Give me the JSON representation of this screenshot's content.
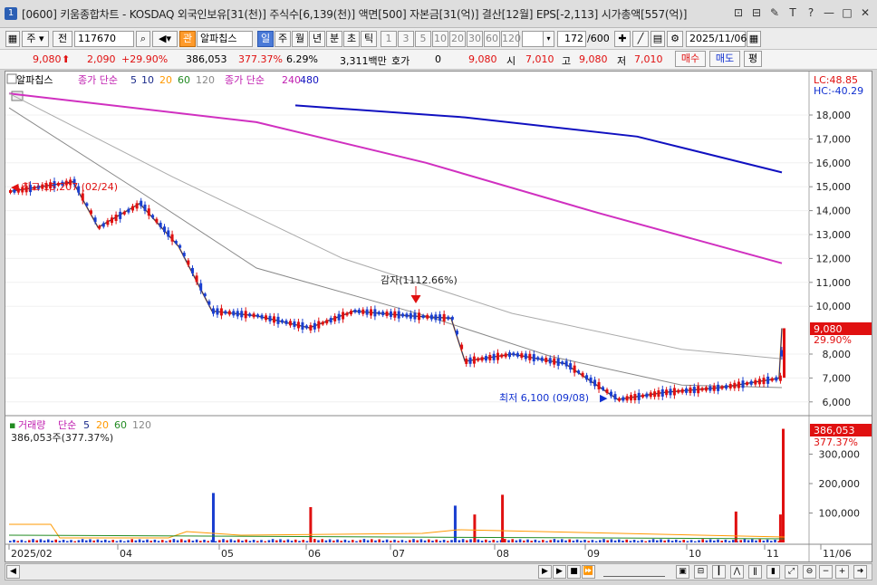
{
  "window": {
    "badge": "1",
    "title": "[0600] 키움종합차트 - KOSDAQ 외국인보유[31(천)] 주식수[6,139(천)] 액면[500] 자본금[31(억)] 결산[12월] EPS[-2,113] 시가총액[557(억)]",
    "buttons": [
      "⊡",
      "⊟",
      "✎",
      "T",
      "?",
      "—",
      "□",
      "✕"
    ]
  },
  "toolbar": {
    "menu_label": "주",
    "all_label": "전",
    "code_value": "117670",
    "name_tag": "관",
    "stock_name": "알파칩스",
    "periods": [
      "일",
      "주",
      "월",
      "년",
      "분",
      "초",
      "틱"
    ],
    "active_period": "일",
    "intervals": [
      "1",
      "3",
      "5",
      "10",
      "20",
      "30",
      "60",
      "120"
    ],
    "count_value": "172",
    "count_total": "/600",
    "date_value": "2025/11/06"
  },
  "quote": {
    "price": "9,080",
    "change": "2,090",
    "change_pct": "+29.90%",
    "volume": "386,053",
    "vol_ratio": "377.37%",
    "turnover": "6.29%",
    "amount": "3,311백만",
    "bid_label": "호가",
    "bid_value": "0",
    "bid_price": "9,080",
    "open_label": "시",
    "open": "7,010",
    "high_label": "고",
    "high": "9,080",
    "low_label": "저",
    "low": "7,010",
    "buy_label": "매수",
    "sell_label": "매도",
    "eval_label": "평"
  },
  "colors": {
    "up": "#e01010",
    "down": "#1a3fd0",
    "ma5": "#1a2a8a",
    "ma10": "#ff9900",
    "ma20": "#228b22",
    "ma60": "#888888",
    "ma120": "#aaaaaa",
    "ma240": "#d030c0",
    "ma480": "#1010c0"
  },
  "chart_data": [
    {
      "type": "candlestick",
      "title": "알파칩스",
      "legend": {
        "ma_label": "종가 단순",
        "ma_periods": [
          "5",
          "10",
          "20",
          "60",
          "120"
        ],
        "ma_long_label": "종가 단순",
        "ma_long_periods": [
          "240",
          "480"
        ]
      },
      "corner_labels": {
        "lc": "LC:48.85",
        "hc": "HC:-40.29"
      },
      "y_ticks": [
        "18,000",
        "17,000",
        "16,000",
        "15,000",
        "14,000",
        "13,000",
        "12,000",
        "11,000",
        "10,000",
        "8,000",
        "7,000",
        "6,000"
      ],
      "ylim": [
        5800,
        19000
      ],
      "current_price": "9,080",
      "current_pct": "29.90%",
      "annotations": {
        "high": "최고 15,207 (02/24)",
        "low": "최저 6,100 (09/08)",
        "event": "감자(1112.66%)"
      },
      "x_labels": [
        "2025/02",
        "04",
        "05",
        "06",
        "07",
        "08",
        "09",
        "10",
        "11",
        "11/06"
      ],
      "price_series": [
        {
          "x": "2025-02-01",
          "close": 14800
        },
        {
          "x": "2025-02-24",
          "close": 15207
        },
        {
          "x": "2025-03-05",
          "close": 13300
        },
        {
          "x": "2025-03-20",
          "close": 14300
        },
        {
          "x": "2025-04-03",
          "close": 12500
        },
        {
          "x": "2025-04-15",
          "close": 9800
        },
        {
          "x": "2025-05-01",
          "close": 9600
        },
        {
          "x": "2025-05-20",
          "close": 9100
        },
        {
          "x": "2025-06-05",
          "close": 9800
        },
        {
          "x": "2025-06-25",
          "close": 9600
        },
        {
          "x": "2025-07-10",
          "close": 9500
        },
        {
          "x": "2025-07-15",
          "close": 7700
        },
        {
          "x": "2025-08-01",
          "close": 8000
        },
        {
          "x": "2025-08-20",
          "close": 7600
        },
        {
          "x": "2025-09-08",
          "close": 6100
        },
        {
          "x": "2025-09-25",
          "close": 6400
        },
        {
          "x": "2025-10-15",
          "close": 6600
        },
        {
          "x": "2025-11-05",
          "close": 6990
        },
        {
          "x": "2025-11-06",
          "close": 9080
        }
      ],
      "ma240": [
        {
          "x": "2025-02-01",
          "y": 18900
        },
        {
          "x": "2025-05-01",
          "y": 17700
        },
        {
          "x": "2025-07-01",
          "y": 16000
        },
        {
          "x": "2025-09-01",
          "y": 13900
        },
        {
          "x": "2025-11-06",
          "y": 11800
        }
      ],
      "ma480": [
        {
          "x": "2025-05-15",
          "y": 18400
        },
        {
          "x": "2025-07-15",
          "y": 17900
        },
        {
          "x": "2025-09-15",
          "y": 17100
        },
        {
          "x": "2025-11-06",
          "y": 15600
        }
      ],
      "ma120": [
        {
          "x": "2025-02-01",
          "y": 18900
        },
        {
          "x": "2025-04-01",
          "y": 15400
        },
        {
          "x": "2025-06-01",
          "y": 12000
        },
        {
          "x": "2025-08-01",
          "y": 9700
        },
        {
          "x": "2025-10-01",
          "y": 8200
        },
        {
          "x": "2025-11-06",
          "y": 7800
        }
      ],
      "ma60": [
        {
          "x": "2025-02-01",
          "y": 18300
        },
        {
          "x": "2025-03-20",
          "y": 14800
        },
        {
          "x": "2025-05-01",
          "y": 11600
        },
        {
          "x": "2025-07-01",
          "y": 9600
        },
        {
          "x": "2025-08-15",
          "y": 7900
        },
        {
          "x": "2025-10-01",
          "y": 6700
        },
        {
          "x": "2025-11-06",
          "y": 6600
        }
      ]
    },
    {
      "type": "bar",
      "title": "거래량",
      "legend": {
        "ma_label": "단순",
        "ma_periods": [
          "5",
          "20",
          "60",
          "120"
        ]
      },
      "current_label": "386,053주(377.37%)",
      "current_value": "386,053",
      "current_pct": "377.37%",
      "y_ticks": [
        "300,000",
        "200,000",
        "100,000"
      ],
      "ylim": [
        0,
        400000
      ],
      "spikes": [
        {
          "x": "2025-04-15",
          "value": 168000,
          "dir": "down"
        },
        {
          "x": "2025-05-20",
          "value": 120000,
          "dir": "up"
        },
        {
          "x": "2025-07-11",
          "value": 125000,
          "dir": "down"
        },
        {
          "x": "2025-07-18",
          "value": 95000,
          "dir": "up"
        },
        {
          "x": "2025-07-28",
          "value": 162000,
          "dir": "up"
        },
        {
          "x": "2025-10-20",
          "value": 105000,
          "dir": "up"
        },
        {
          "x": "2025-11-05",
          "value": 95000,
          "dir": "up"
        },
        {
          "x": "2025-11-06",
          "value": 386053,
          "dir": "up"
        }
      ],
      "baseline": 8000
    }
  ]
}
